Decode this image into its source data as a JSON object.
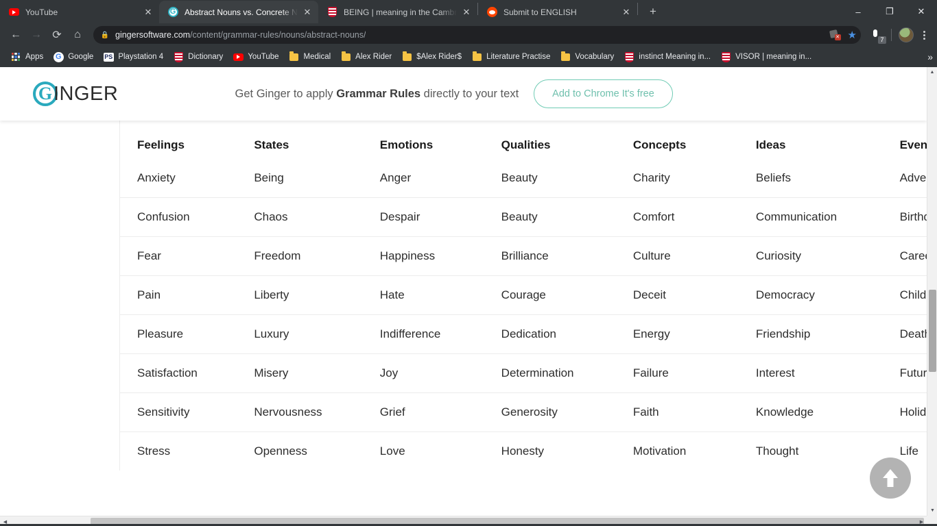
{
  "browser": {
    "tabs": [
      {
        "title": "YouTube",
        "icon": "youtube-favicon",
        "active": false,
        "close_label": "✕"
      },
      {
        "title": "Abstract Nouns vs. Concrete Nou",
        "icon": "ginger-favicon",
        "active": true,
        "close_label": "✕"
      },
      {
        "title": "BEING | meaning in the Cambrid",
        "icon": "cambridge-favicon",
        "active": false,
        "close_label": "✕"
      },
      {
        "title": "Submit to ENGLISH",
        "icon": "reddit-favicon",
        "active": false,
        "close_label": "✕"
      }
    ],
    "new_tab_label": "+",
    "window_controls": {
      "minimize": "–",
      "maximize": "❐",
      "close": "✕"
    },
    "nav": {
      "back": "←",
      "forward": "→",
      "reload": "⟳",
      "home": "⌂"
    },
    "address": {
      "lock_icon": "lock-icon",
      "domain": "gingersoftware.com",
      "path": "/content/grammar-rules/nouns/abstract-nouns/",
      "full_url": "gingersoftware.com/content/grammar-rules/nouns/abstract-nouns/"
    },
    "extension_badge_count": "7",
    "bookmarks": [
      {
        "label": "Apps",
        "icon": "apps-grid-icon"
      },
      {
        "label": "Google",
        "icon": "google-favicon"
      },
      {
        "label": "Playstation 4",
        "icon": "playstation-favicon"
      },
      {
        "label": "Dictionary",
        "icon": "cambridge-favicon"
      },
      {
        "label": "YouTube",
        "icon": "youtube-favicon"
      },
      {
        "label": "Medical",
        "icon": "folder-icon"
      },
      {
        "label": "Alex Rider",
        "icon": "folder-icon"
      },
      {
        "label": "$Alex Rider$",
        "icon": "folder-icon"
      },
      {
        "label": "Literature Practise",
        "icon": "folder-icon"
      },
      {
        "label": "Vocabulary",
        "icon": "folder-icon"
      },
      {
        "label": "instinct Meaning in...",
        "icon": "cambridge-favicon"
      },
      {
        "label": "VISOR | meaning in...",
        "icon": "cambridge-favicon"
      }
    ],
    "bookmarks_overflow_label": "»"
  },
  "site": {
    "logo_letter": "G",
    "logo_text": "INGER",
    "banner": {
      "text_before": "Get Ginger to apply ",
      "text_bold": "Grammar Rules",
      "text_after": " directly to your text",
      "cta_label": "Add to Chrome It's free",
      "cta_border_color": "#6fcbb4",
      "cta_text_color": "#6fc0ad"
    },
    "scroll_top_button": "scroll-to-top-button"
  },
  "table": {
    "headers": [
      "Feelings",
      "States",
      "Emotions",
      "Qualities",
      "Concepts",
      "Ideas",
      "Events"
    ],
    "rows": [
      [
        "Anxiety",
        "Being",
        "Anger",
        "Beauty",
        "Charity",
        "Beliefs",
        "Adventure"
      ],
      [
        "Confusion",
        "Chaos",
        "Despair",
        "Beauty",
        "Comfort",
        "Communication",
        "Birthday"
      ],
      [
        "Fear",
        "Freedom",
        "Happiness",
        "Brilliance",
        "Culture",
        "Curiosity",
        "Career"
      ],
      [
        "Pain",
        "Liberty",
        "Hate",
        "Courage",
        "Deceit",
        "Democracy",
        "Childhood"
      ],
      [
        "Pleasure",
        "Luxury",
        "Indifference",
        "Dedication",
        "Energy",
        "Friendship",
        "Death"
      ],
      [
        "Satisfaction",
        "Misery",
        "Joy",
        "Determination",
        "Failure",
        "Interest",
        "Future"
      ],
      [
        "Sensitivity",
        "Nervousness",
        "Grief",
        "Generosity",
        "Faith",
        "Knowledge",
        "Holiday"
      ],
      [
        "Stress",
        "Openness",
        "Love",
        "Honesty",
        "Motivation",
        "Thought",
        "Life"
      ]
    ]
  },
  "scrollbars": {
    "vertical_up": "▲",
    "vertical_down": "▼",
    "horizontal_left": "◀",
    "horizontal_right": "▶"
  }
}
